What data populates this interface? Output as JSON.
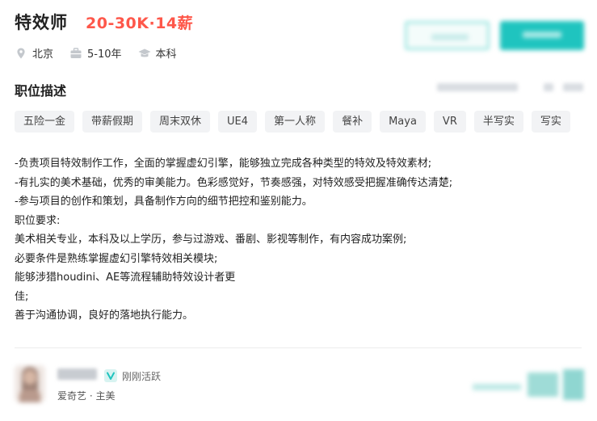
{
  "job": {
    "title": "特效师",
    "salary": "20-30K·14薪"
  },
  "meta": {
    "location": "北京",
    "experience": "5-10年",
    "education": "本科",
    "location_icon": "location-pin-icon",
    "experience_icon": "briefcase-icon",
    "education_icon": "graduation-cap-icon"
  },
  "section": {
    "title": "职位描述"
  },
  "tags": [
    "五险一金",
    "带薪假期",
    "周末双休",
    "UE4",
    "第一人称",
    "餐补",
    "Maya",
    "VR",
    "半写实",
    "写实"
  ],
  "description": [
    "-负责项目特效制作工作，全面的掌握虚幻引擎，能够独立完成各种类型的特效及特效素材;",
    "-有扎实的美术基础，优秀的审美能力。色彩感觉好，节奏感强，对特效感受把握准确传达清楚;",
    "-参与项目的创作和策划，具备制作方向的细节把控和鉴别能力。",
    "职位要求:",
    "美术相关专业，本科及以上学历，参与过游戏、番剧、影视等制作，有内容成功案例;",
    "必要条件是熟练掌握虚幻引擎特效相关模块;",
    "能够涉猎houdini、AE等流程辅助特效设计者更",
    "佳;",
    "善于沟通协调，良好的落地执行能力。"
  ],
  "recruiter": {
    "status": "刚刚活跃",
    "company_role": "爱奇艺 · 主美",
    "verify_icon": "verified-v-icon"
  },
  "colors": {
    "salary": "#fe574a",
    "accent": "#1fc4bf",
    "tag_bg": "#f2f3f5"
  }
}
